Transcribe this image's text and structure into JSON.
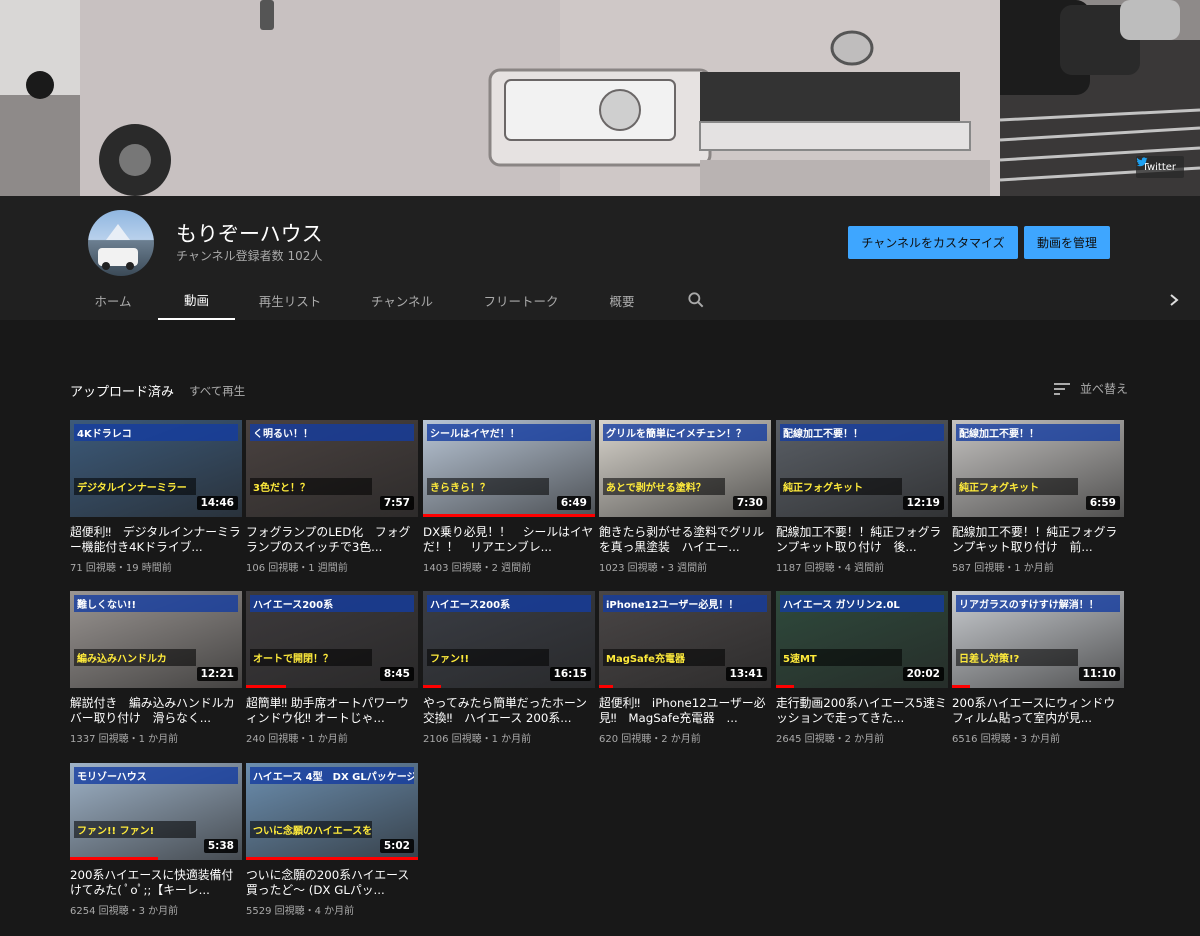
{
  "banner": {
    "twitter_label": "Twitter"
  },
  "channel": {
    "name": "もりぞーハウス",
    "subscribers": "チャンネル登録者数 102人",
    "customize_label": "チャンネルをカスタマイズ",
    "manage_label": "動画を管理"
  },
  "tabs": [
    {
      "label": "ホーム"
    },
    {
      "label": "動画",
      "active": true
    },
    {
      "label": "再生リスト"
    },
    {
      "label": "チャンネル"
    },
    {
      "label": "フリートーク"
    },
    {
      "label": "概要"
    }
  ],
  "section": {
    "title": "アップロード済み",
    "play_all": "すべて再生",
    "sort_label": "並べ替え"
  },
  "videos": [
    {
      "title": "超便利‼︎　デジタルインナーミラー機能付き4Kドライブ...",
      "meta": "71 回視聴・19 時間前",
      "duration": "14:46",
      "band1": "4Kドラレコ",
      "band2": "デジタルインナーミラー",
      "color": "#3c5a7a",
      "progress": 0
    },
    {
      "title": "フォグランプのLED化　フォグランプのスイッチで3色...",
      "meta": "106 回視聴・1 週間前",
      "duration": "7:57",
      "band1": "く明るい！！",
      "band2": "3色だと！？",
      "color": "#4a4240",
      "progress": 0
    },
    {
      "title": "DX乗り必見！！　シールはイヤだ！！　リアエンブレ...",
      "meta": "1403 回視聴・2 週間前",
      "duration": "6:49",
      "band1": "シールはイヤだ！！",
      "band2": "きらきら！？",
      "color": "#b9c6d6",
      "progress": 1
    },
    {
      "title": "飽きたら剥がせる塗料でグリルを真っ黒塗装　ハイエー...",
      "meta": "1023 回視聴・3 週間前",
      "duration": "7:30",
      "band1": "グリルを簡単にイメチェン！？",
      "band2": "あとで剥がせる塗料？",
      "color": "#d8d4cc",
      "progress": 0
    },
    {
      "title": "配線加工不要！！純正フォグランプキット取り付け　後...",
      "meta": "1187 回視聴・4 週間前",
      "duration": "12:19",
      "band1": "配線加工不要！！",
      "band2": "純正フォグキット",
      "color": "#5a5f66",
      "progress": 0
    },
    {
      "title": "配線加工不要！！純正フォグランプキット取り付け　前...",
      "meta": "587 回視聴・1 か月前",
      "duration": "6:59",
      "band1": "配線加工不要！！",
      "band2": "純正フォグキット",
      "color": "#c4c2c0",
      "progress": 0
    },
    {
      "title": "解説付き　編み込みハンドルカバー取り付け　滑らなく...",
      "meta": "1337 回視聴・1 か月前",
      "duration": "12:21",
      "band1": "難しくない!!",
      "band2": "編み込みハンドルカ",
      "color": "#9a9592",
      "progress": 0
    },
    {
      "title": "超簡単‼︎ 助手席オートパワーウィンドウ化‼︎ オートじゃ...",
      "meta": "240 回視聴・1 か月前",
      "duration": "8:45",
      "band1": "ハイエース200系",
      "band2": "オートで開閉！？",
      "color": "#3d3a3c",
      "progress": 1
    },
    {
      "title": "やってみたら簡単だったホーン交換‼︎　ハイエース 200系...",
      "meta": "2106 回視聴・1 か月前",
      "duration": "16:15",
      "band1": "ハイエース200系",
      "band2": "ファン!!",
      "color": "#3a3d44",
      "progress": 1
    },
    {
      "title": "超便利‼︎　iPhone12ユーザー必見‼︎　MagSafe充電器　...",
      "meta": "620 回視聴・2 か月前",
      "duration": "13:41",
      "band1": "iPhone12ユーザー必見！！",
      "band2": "MagSafe充電器",
      "color": "#4a4646",
      "progress": 1
    },
    {
      "title": "走行動画200系ハイエース5速ミッションで走ってきた...",
      "meta": "2645 回視聴・2 か月前",
      "duration": "20:02",
      "band1": "ハイエース ガソリン2.0L",
      "band2": "5速MT",
      "color": "#2f4a3c",
      "progress": 1
    },
    {
      "title": "200系ハイエースにウィンドウフィルム貼って室内が見...",
      "meta": "6516 回視聴・3 か月前",
      "duration": "11:10",
      "band1": "リアガラスのすけすけ解消！！",
      "band2": "日差し対策!?",
      "color": "#c9ccd0",
      "progress": 1
    },
    {
      "title": "200系ハイエースに快適装備付けてみた( ﾟoﾟ;;【キーレ...",
      "meta": "6254 回視聴・3 か月前",
      "duration": "5:38",
      "band1": "モリゾーハウス",
      "band2": "ファン!! ファン!",
      "color": "#9fb3c8",
      "progress": 1
    },
    {
      "title": "ついに念願の200系ハイエース買ったど〜 (DX GLパッ...",
      "meta": "5529 回視聴・4 か月前",
      "duration": "5:02",
      "band1": "ハイエース 4型　DX GLパッケージ",
      "band2": "ついに念願のハイエースを買ったど!!",
      "color": "#6c8fb0",
      "progress": 1
    }
  ]
}
